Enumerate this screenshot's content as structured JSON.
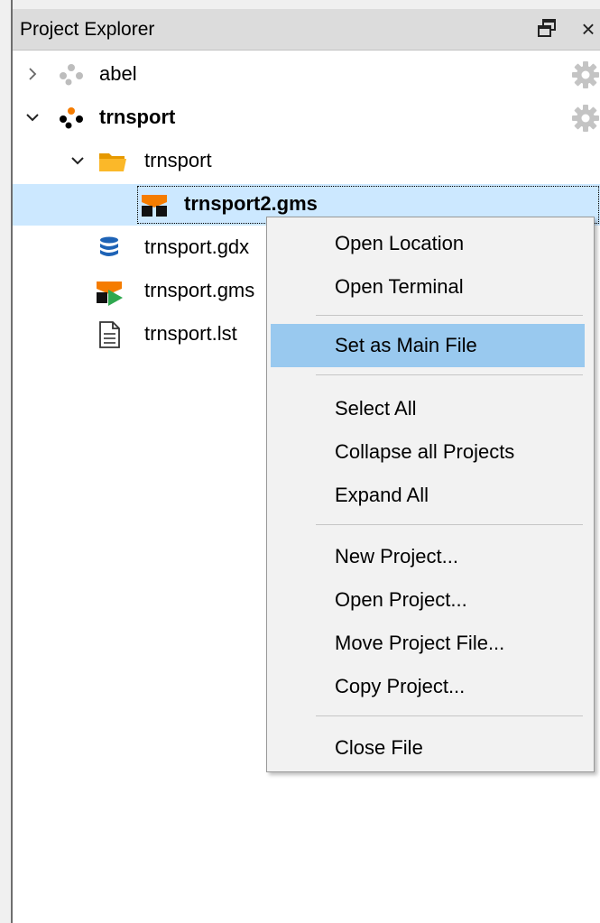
{
  "panel": {
    "title": "Project Explorer",
    "float_icon": "float-window-icon",
    "close_label": "×"
  },
  "tree": {
    "items": [
      {
        "label": "abel",
        "icon": "project-icon",
        "expanded": false
      },
      {
        "label": "trnsport",
        "icon": "project-icon",
        "expanded": true
      },
      {
        "label": "trnsport",
        "icon": "folder-icon",
        "expanded": true
      },
      {
        "label": "trnsport2.gms",
        "icon": "gams-file-icon",
        "selected": true
      },
      {
        "label": "trnsport.gdx",
        "icon": "database-icon"
      },
      {
        "label": "trnsport.gms",
        "icon": "gams-run-file-icon"
      },
      {
        "label": "trnsport.lst",
        "icon": "document-icon"
      }
    ]
  },
  "context_menu": {
    "items": [
      {
        "label": "Open Location"
      },
      {
        "label": "Open Terminal"
      },
      {
        "label": "Set as Main File",
        "highlighted": true
      },
      {
        "label": "Select All"
      },
      {
        "label": "Collapse all Projects"
      },
      {
        "label": "Expand All"
      },
      {
        "label": "New Project..."
      },
      {
        "label": "Open Project..."
      },
      {
        "label": "Move Project File..."
      },
      {
        "label": "Copy Project..."
      },
      {
        "label": "Close File"
      }
    ]
  },
  "colors": {
    "selection": "#cce8ff",
    "menu_highlight": "#99c9ef",
    "folder": "#f9a825",
    "gams_orange": "#f57c00",
    "database_blue": "#1e63b6"
  }
}
